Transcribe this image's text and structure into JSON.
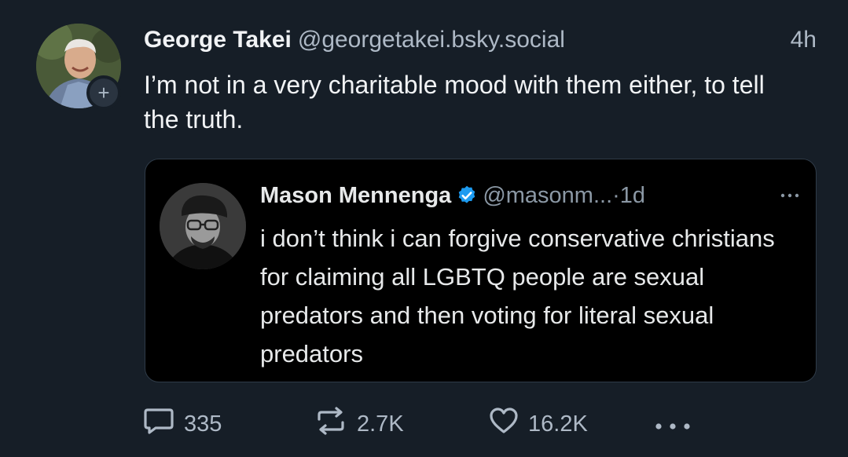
{
  "post": {
    "author_name": "George Takei",
    "author_handle": "@georgetakei.bsky.social",
    "timestamp": "4h",
    "text": "I’m not in a very charitable mood with them either, to tell the truth.",
    "follow_badge": "+"
  },
  "quote": {
    "author_name": "Mason Mennenga",
    "author_handle": "@masonm...",
    "separator": "·",
    "timestamp": "1d",
    "text": "i don’t think i can forgive conservative christians for claiming all LGBTQ people are sexual predators and then voting for literal sexual predators",
    "verified_color": "#1d9bf0"
  },
  "actions": {
    "reply_count": "335",
    "repost_count": "2.7K",
    "like_count": "16.2K"
  },
  "icons": [
    "reply-icon",
    "repost-icon",
    "heart-icon",
    "more-icon",
    "verified-icon",
    "follow-plus-icon"
  ]
}
